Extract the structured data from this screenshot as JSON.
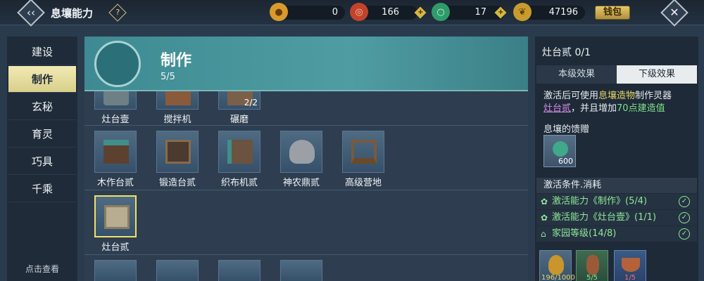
{
  "header": {
    "title": "息壤能力",
    "back_icon": "‹‹",
    "help_icon": "?",
    "close_icon": "✕",
    "wallet_label": "钱包",
    "resources": [
      {
        "icon": "gold-pouch-icon",
        "value": "0"
      },
      {
        "icon": "red-coin-icon",
        "value": "166"
      },
      {
        "icon": "jade-ring-icon",
        "value": "17"
      },
      {
        "icon": "gold-leaf-icon",
        "value": "47196"
      }
    ]
  },
  "sidebar": {
    "items": [
      {
        "label": "建设",
        "active": false
      },
      {
        "label": "制作",
        "active": true
      },
      {
        "label": "玄秘",
        "active": false
      },
      {
        "label": "育灵",
        "active": false
      },
      {
        "label": "巧具",
        "active": false
      },
      {
        "label": "千乘",
        "active": false
      }
    ],
    "footer": "点击查看"
  },
  "main": {
    "banner_title": "制作",
    "banner_count": "5/5",
    "rows": [
      {
        "items": [
          {
            "label": "灶台壹",
            "badge": ""
          },
          {
            "label": "搅拌机",
            "badge": ""
          },
          {
            "label": "碾磨",
            "badge": "2/2"
          }
        ]
      },
      {
        "items": [
          {
            "label": "木作台贰",
            "badge": ""
          },
          {
            "label": "锻造台贰",
            "badge": ""
          },
          {
            "label": "织布机贰",
            "badge": ""
          },
          {
            "label": "神农鼎贰",
            "badge": ""
          },
          {
            "label": "高级营地",
            "badge": ""
          }
        ]
      },
      {
        "items": [
          {
            "label": "灶台贰",
            "badge": "",
            "selected": true
          }
        ]
      }
    ]
  },
  "detail": {
    "title": "灶台贰 0/1",
    "tabs": [
      "本级效果",
      "下级效果"
    ],
    "active_tab": 1,
    "desc": {
      "p1": "激活后可使用",
      "p2": "息壤造物",
      "p3": "制作灵器",
      "p4": "灶台贰",
      "p5": "，并且增加",
      "p6": "70点建造值"
    },
    "gift_title": "息壤的馈赠",
    "gift_count": "600",
    "cond_title": "激活条件.消耗",
    "conditions": [
      {
        "text": "激活能力《制作》(5/4)"
      },
      {
        "text": "激活能力《灶台壹》(1/1)"
      },
      {
        "text": "家园等级(14/8)"
      }
    ],
    "materials": [
      {
        "count": "196/1000",
        "color": "#e7d768"
      },
      {
        "count": "5/5",
        "color": "#8fe89a"
      },
      {
        "count": "1/5",
        "color": "#ff6b6b"
      }
    ],
    "check_icon": "✓"
  }
}
